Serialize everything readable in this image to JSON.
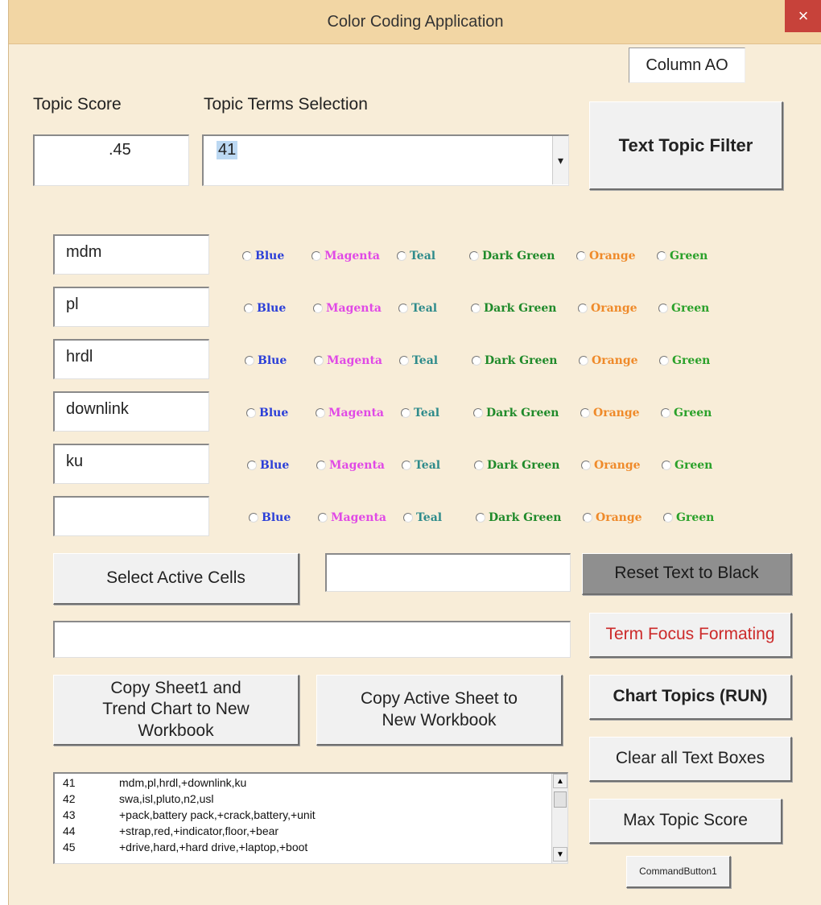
{
  "window": {
    "title": "Color Coding Application",
    "close_glyph": "×"
  },
  "column_label": "Column AO",
  "topic_score": {
    "label": "Topic Score",
    "value": ".45"
  },
  "topic_terms": {
    "label": "Topic Terms Selection",
    "value": "41",
    "dropdown_glyph": "▾"
  },
  "buttons": {
    "text_topic_filter": "Text Topic Filter",
    "select_active_cells": "Select Active Cells",
    "reset_text_to_black": "Reset Text to Black",
    "term_focus_formating": "Term Focus Formating",
    "copy_sheet1_and_trend": "Copy Sheet1 and Trend Chart to New Workbook",
    "copy_active_sheet": "Copy Active Sheet to New Workbook",
    "chart_topics_run": "Chart Topics (RUN)",
    "clear_all_text_boxes": "Clear all Text Boxes",
    "max_topic_score": "Max Topic Score",
    "command_button1": "CommandButton1"
  },
  "color_options": [
    "Blue",
    "Magenta",
    "Teal",
    "Dark Green",
    "Orange",
    "Green"
  ],
  "colors": {
    "blue": "#2b3fd8",
    "magenta": "#e049e6",
    "teal": "#2e8b8b",
    "dark_green": "#1f8a2a",
    "orange": "#ef8a2a",
    "green": "#2aa12a",
    "title_bar": "#f2d6a4",
    "window_bg": "#f8edd8",
    "close_button": "#c7423a",
    "term_focus_text": "#cc2a2a"
  },
  "term_rows": [
    {
      "term": "mdm"
    },
    {
      "term": "pl"
    },
    {
      "term": "hrdl"
    },
    {
      "term": "downlink"
    },
    {
      "term": "ku"
    },
    {
      "term": ""
    }
  ],
  "active_cells_box": {
    "value": ""
  },
  "term_focus_box": {
    "value": ""
  },
  "topic_list": [
    {
      "id": "41",
      "terms": "mdm,pl,hrdl,+downlink,ku"
    },
    {
      "id": "42",
      "terms": "swa,isl,pluto,n2,usl"
    },
    {
      "id": "43",
      "terms": "+pack,battery pack,+crack,battery,+unit"
    },
    {
      "id": "44",
      "terms": "+strap,red,+indicator,floor,+bear"
    },
    {
      "id": "45",
      "terms": "+drive,hard,+hard drive,+laptop,+boot"
    }
  ],
  "scroll": {
    "up_glyph": "▲",
    "down_glyph": "▼"
  }
}
